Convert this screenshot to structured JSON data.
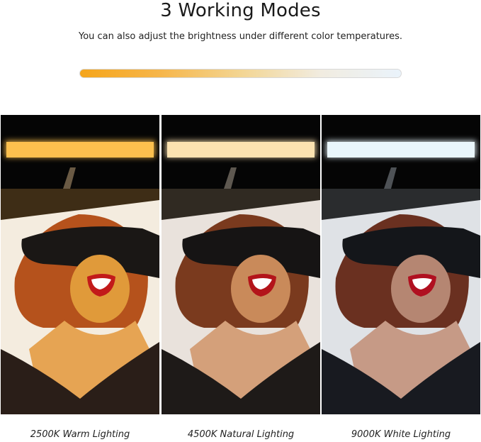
{
  "header": {
    "title": "3 Working Modes",
    "subtitle": "You can also adjust the brightness under different color temperatures."
  },
  "modes": [
    {
      "label": "2500K Warm Lighting",
      "light_color": "#fcc04e",
      "tint": "#e09a3a",
      "backdrop": "#f4ecdf"
    },
    {
      "label": "4500K Natural Lighting",
      "light_color": "#fbe2b0",
      "tint": "#c98a5a",
      "backdrop": "#e9e2dc"
    },
    {
      "label": "9000K White Lighting",
      "light_color": "#e9f6fb",
      "tint": "#b58672",
      "backdrop": "#dfe2e6"
    }
  ],
  "colors": {
    "gradient_start": "#f5a51a",
    "gradient_end": "#eaf3fb"
  }
}
